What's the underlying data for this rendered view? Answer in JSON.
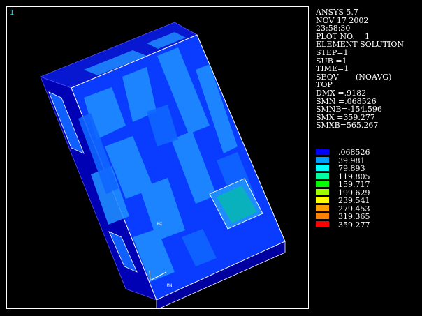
{
  "window_number": "1",
  "panel_lines": [
    "ANSYS 5.7",
    "NOV 17 2002",
    "23:58:30",
    "PLOT NO.    1",
    "ELEMENT SOLUTION",
    "STEP=1",
    "SUB =1",
    "TIME=1",
    "SEQV       (NOAVG)",
    "TOP",
    "DMX =.9182",
    "SMN =.068526",
    "SMNB=-154.596",
    "SMX =359.277",
    "SMXB=565.267"
  ],
  "legend": [
    {
      "value": ".068526",
      "color": "#0000ff"
    },
    {
      "value": "39.981",
      "color": "#00a0ff"
    },
    {
      "value": "79.893",
      "color": "#00ffff"
    },
    {
      "value": "119.805",
      "color": "#00ffa0"
    },
    {
      "value": "159.717",
      "color": "#00ff00"
    },
    {
      "value": "199.629",
      "color": "#a0ff00"
    },
    {
      "value": "239.541",
      "color": "#ffff00"
    },
    {
      "value": "279.453",
      "color": "#ffa000"
    },
    {
      "value": "319.365",
      "color": "#ff8000"
    },
    {
      "value": "359.277",
      "color": "#ff0000"
    }
  ],
  "markers": {
    "mx": "MX",
    "mn": "MN"
  },
  "colors": {
    "background": "#000000",
    "frame": "#ffffff",
    "model_dark": "#0000c8",
    "model_mid": "#0a3cff",
    "model_light": "#1e8cff"
  }
}
